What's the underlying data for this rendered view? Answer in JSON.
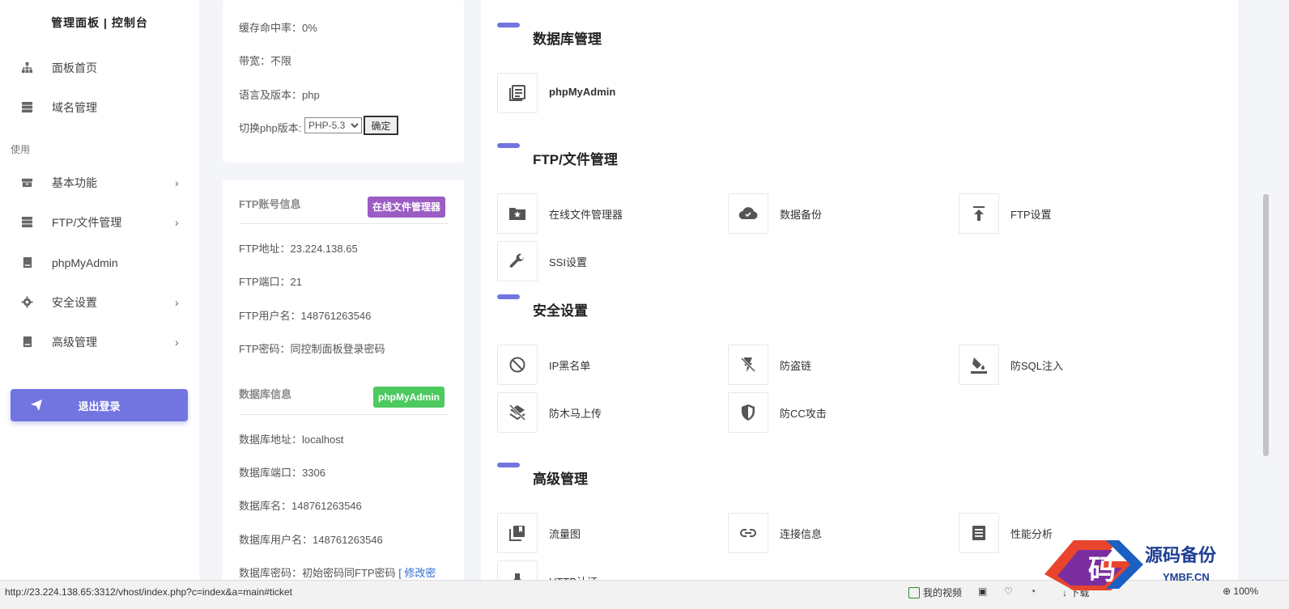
{
  "sidebar": {
    "brand": "管理面板 | 控制台",
    "items_top": [
      {
        "label": "面板首页",
        "icon": "sitemap-icon"
      },
      {
        "label": "域名管理",
        "icon": "server-icon"
      }
    ],
    "section_label": "使用",
    "items": [
      {
        "label": "基本功能",
        "icon": "inbox-icon",
        "has_children": true
      },
      {
        "label": "FTP/文件管理",
        "icon": "server-icon",
        "has_children": true
      },
      {
        "label": "phpMyAdmin",
        "icon": "book-icon",
        "has_children": false
      },
      {
        "label": "安全设置",
        "icon": "gear-icon",
        "has_children": true
      },
      {
        "label": "高级管理",
        "icon": "book-icon",
        "has_children": true
      }
    ],
    "logout_label": "退出登录"
  },
  "site_card": {
    "cache_hit_rate": "缓存命中率：0%",
    "bandwidth": "带宽：不限",
    "language_version": "语言及版本：php",
    "switch_php_label": "切换php版本:",
    "php_version_selected": "PHP-5.3",
    "confirm_label": "确定"
  },
  "ftp_card": {
    "title": "FTP账号信息",
    "file_manager_button": "在线文件管理器",
    "ftp_address": "FTP地址：23.224.138.65",
    "ftp_port": "FTP端口：21",
    "ftp_username": "FTP用户名：148761263546",
    "ftp_password": "FTP密码：同控制面板登录密码",
    "db_title": "数据库信息",
    "phpmyadmin_button": "phpMyAdmin",
    "db_address": "数据库地址：localhost",
    "db_port": "数据库端口：3306",
    "db_name": "数据库名：148761263546",
    "db_username": "数据库用户名：148761263546",
    "db_password": "数据库密码：初始密码同FTP密码",
    "db_password_link": "[ 修改密"
  },
  "panel": {
    "sections": [
      {
        "title": "数据库管理",
        "tiles": [
          {
            "label": "phpMyAdmin",
            "icon": "document-list-icon"
          }
        ]
      },
      {
        "title": "FTP/文件管理",
        "tiles": [
          {
            "label": "在线文件管理器",
            "icon": "folder-star-icon"
          },
          {
            "label": "数据备份",
            "icon": "cloud-icon"
          },
          {
            "label": "FTP设置",
            "icon": "upload-icon"
          },
          {
            "label": "SSI设置",
            "icon": "wrench-icon"
          }
        ]
      },
      {
        "title": "安全设置",
        "tiles": [
          {
            "label": "IP黑名单",
            "icon": "block-icon"
          },
          {
            "label": "防盗链",
            "icon": "flash-off-icon"
          },
          {
            "label": "防SQL注入",
            "icon": "paint-bucket-icon"
          },
          {
            "label": "防木马上传",
            "icon": "layers-off-icon"
          },
          {
            "label": "防CC攻击",
            "icon": "shield-icon"
          }
        ]
      },
      {
        "title": "高级管理",
        "tiles": [
          {
            "label": "流量图",
            "icon": "library-icon"
          },
          {
            "label": "连接信息",
            "icon": "link-icon"
          },
          {
            "label": "性能分析",
            "icon": "list-box-icon"
          },
          {
            "label": "HTTP认证",
            "icon": "pin-icon"
          }
        ]
      }
    ]
  },
  "statusbar": {
    "url": "http://23.224.138.65:3312/vhost/index.php?c=index&a=main#ticket",
    "my_video": "我的视频",
    "download": "下载",
    "zoom": "100%"
  },
  "watermark": {
    "logo_char": "码",
    "brand_cn": "源码备份",
    "brand_domain": "YMBF.CN"
  },
  "colors": {
    "accent": "#7275e0",
    "purple_button": "#9b5cc4",
    "green_button": "#4cc95f"
  }
}
